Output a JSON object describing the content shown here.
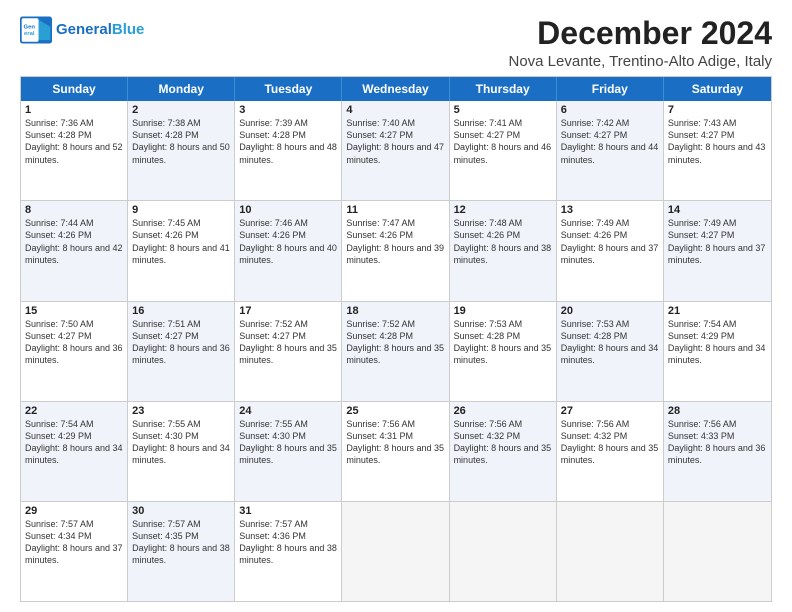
{
  "logo": {
    "text_general": "General",
    "text_blue": "Blue"
  },
  "header": {
    "title": "December 2024",
    "subtitle": "Nova Levante, Trentino-Alto Adige, Italy"
  },
  "days": [
    "Sunday",
    "Monday",
    "Tuesday",
    "Wednesday",
    "Thursday",
    "Friday",
    "Saturday"
  ],
  "rows": [
    [
      {
        "num": "1",
        "rise": "Sunrise: 7:36 AM",
        "set": "Sunset: 4:28 PM",
        "day": "Daylight: 8 hours and 52 minutes.",
        "alt": false
      },
      {
        "num": "2",
        "rise": "Sunrise: 7:38 AM",
        "set": "Sunset: 4:28 PM",
        "day": "Daylight: 8 hours and 50 minutes.",
        "alt": true
      },
      {
        "num": "3",
        "rise": "Sunrise: 7:39 AM",
        "set": "Sunset: 4:28 PM",
        "day": "Daylight: 8 hours and 48 minutes.",
        "alt": false
      },
      {
        "num": "4",
        "rise": "Sunrise: 7:40 AM",
        "set": "Sunset: 4:27 PM",
        "day": "Daylight: 8 hours and 47 minutes.",
        "alt": true
      },
      {
        "num": "5",
        "rise": "Sunrise: 7:41 AM",
        "set": "Sunset: 4:27 PM",
        "day": "Daylight: 8 hours and 46 minutes.",
        "alt": false
      },
      {
        "num": "6",
        "rise": "Sunrise: 7:42 AM",
        "set": "Sunset: 4:27 PM",
        "day": "Daylight: 8 hours and 44 minutes.",
        "alt": true
      },
      {
        "num": "7",
        "rise": "Sunrise: 7:43 AM",
        "set": "Sunset: 4:27 PM",
        "day": "Daylight: 8 hours and 43 minutes.",
        "alt": false
      }
    ],
    [
      {
        "num": "8",
        "rise": "Sunrise: 7:44 AM",
        "set": "Sunset: 4:26 PM",
        "day": "Daylight: 8 hours and 42 minutes.",
        "alt": true
      },
      {
        "num": "9",
        "rise": "Sunrise: 7:45 AM",
        "set": "Sunset: 4:26 PM",
        "day": "Daylight: 8 hours and 41 minutes.",
        "alt": false
      },
      {
        "num": "10",
        "rise": "Sunrise: 7:46 AM",
        "set": "Sunset: 4:26 PM",
        "day": "Daylight: 8 hours and 40 minutes.",
        "alt": true
      },
      {
        "num": "11",
        "rise": "Sunrise: 7:47 AM",
        "set": "Sunset: 4:26 PM",
        "day": "Daylight: 8 hours and 39 minutes.",
        "alt": false
      },
      {
        "num": "12",
        "rise": "Sunrise: 7:48 AM",
        "set": "Sunset: 4:26 PM",
        "day": "Daylight: 8 hours and 38 minutes.",
        "alt": true
      },
      {
        "num": "13",
        "rise": "Sunrise: 7:49 AM",
        "set": "Sunset: 4:26 PM",
        "day": "Daylight: 8 hours and 37 minutes.",
        "alt": false
      },
      {
        "num": "14",
        "rise": "Sunrise: 7:49 AM",
        "set": "Sunset: 4:27 PM",
        "day": "Daylight: 8 hours and 37 minutes.",
        "alt": true
      }
    ],
    [
      {
        "num": "15",
        "rise": "Sunrise: 7:50 AM",
        "set": "Sunset: 4:27 PM",
        "day": "Daylight: 8 hours and 36 minutes.",
        "alt": false
      },
      {
        "num": "16",
        "rise": "Sunrise: 7:51 AM",
        "set": "Sunset: 4:27 PM",
        "day": "Daylight: 8 hours and 36 minutes.",
        "alt": true
      },
      {
        "num": "17",
        "rise": "Sunrise: 7:52 AM",
        "set": "Sunset: 4:27 PM",
        "day": "Daylight: 8 hours and 35 minutes.",
        "alt": false
      },
      {
        "num": "18",
        "rise": "Sunrise: 7:52 AM",
        "set": "Sunset: 4:28 PM",
        "day": "Daylight: 8 hours and 35 minutes.",
        "alt": true
      },
      {
        "num": "19",
        "rise": "Sunrise: 7:53 AM",
        "set": "Sunset: 4:28 PM",
        "day": "Daylight: 8 hours and 35 minutes.",
        "alt": false
      },
      {
        "num": "20",
        "rise": "Sunrise: 7:53 AM",
        "set": "Sunset: 4:28 PM",
        "day": "Daylight: 8 hours and 34 minutes.",
        "alt": true
      },
      {
        "num": "21",
        "rise": "Sunrise: 7:54 AM",
        "set": "Sunset: 4:29 PM",
        "day": "Daylight: 8 hours and 34 minutes.",
        "alt": false
      }
    ],
    [
      {
        "num": "22",
        "rise": "Sunrise: 7:54 AM",
        "set": "Sunset: 4:29 PM",
        "day": "Daylight: 8 hours and 34 minutes.",
        "alt": true
      },
      {
        "num": "23",
        "rise": "Sunrise: 7:55 AM",
        "set": "Sunset: 4:30 PM",
        "day": "Daylight: 8 hours and 34 minutes.",
        "alt": false
      },
      {
        "num": "24",
        "rise": "Sunrise: 7:55 AM",
        "set": "Sunset: 4:30 PM",
        "day": "Daylight: 8 hours and 35 minutes.",
        "alt": true
      },
      {
        "num": "25",
        "rise": "Sunrise: 7:56 AM",
        "set": "Sunset: 4:31 PM",
        "day": "Daylight: 8 hours and 35 minutes.",
        "alt": false
      },
      {
        "num": "26",
        "rise": "Sunrise: 7:56 AM",
        "set": "Sunset: 4:32 PM",
        "day": "Daylight: 8 hours and 35 minutes.",
        "alt": true
      },
      {
        "num": "27",
        "rise": "Sunrise: 7:56 AM",
        "set": "Sunset: 4:32 PM",
        "day": "Daylight: 8 hours and 35 minutes.",
        "alt": false
      },
      {
        "num": "28",
        "rise": "Sunrise: 7:56 AM",
        "set": "Sunset: 4:33 PM",
        "day": "Daylight: 8 hours and 36 minutes.",
        "alt": true
      }
    ],
    [
      {
        "num": "29",
        "rise": "Sunrise: 7:57 AM",
        "set": "Sunset: 4:34 PM",
        "day": "Daylight: 8 hours and 37 minutes.",
        "alt": false
      },
      {
        "num": "30",
        "rise": "Sunrise: 7:57 AM",
        "set": "Sunset: 4:35 PM",
        "day": "Daylight: 8 hours and 38 minutes.",
        "alt": true
      },
      {
        "num": "31",
        "rise": "Sunrise: 7:57 AM",
        "set": "Sunset: 4:36 PM",
        "day": "Daylight: 8 hours and 38 minutes.",
        "alt": false
      },
      {
        "num": "",
        "rise": "",
        "set": "",
        "day": "",
        "alt": true,
        "empty": true
      },
      {
        "num": "",
        "rise": "",
        "set": "",
        "day": "",
        "alt": false,
        "empty": true
      },
      {
        "num": "",
        "rise": "",
        "set": "",
        "day": "",
        "alt": true,
        "empty": true
      },
      {
        "num": "",
        "rise": "",
        "set": "",
        "day": "",
        "alt": false,
        "empty": true
      }
    ]
  ]
}
